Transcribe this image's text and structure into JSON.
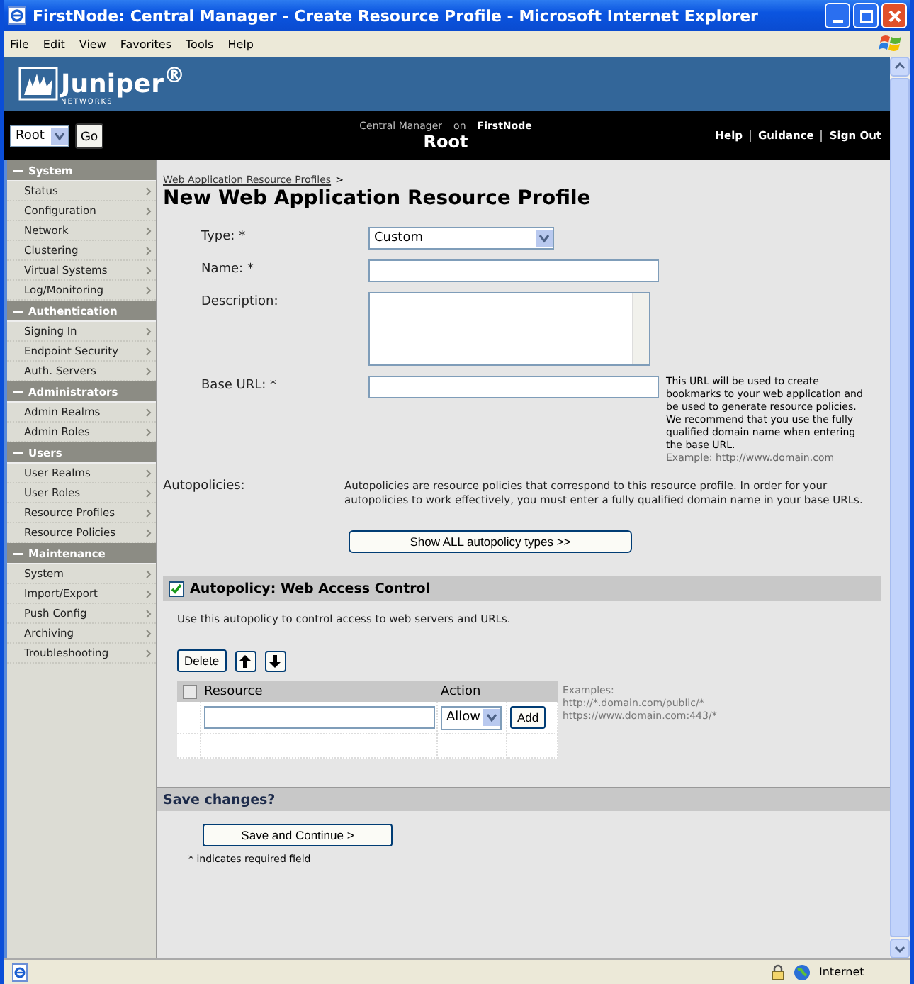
{
  "window": {
    "title": "FirstNode: Central Manager - Create Resource Profile - Microsoft Internet Explorer"
  },
  "menu_bar": [
    "File",
    "Edit",
    "View",
    "Favorites",
    "Tools",
    "Help"
  ],
  "header": {
    "logo_text": "Juniper$^{®}$",
    "logo_subtext": "NETWORKS",
    "context_select": "Root",
    "go_button": "Go",
    "app_name": "Central Manager",
    "on_word": "on",
    "node_name": "FirstNode",
    "title": "Root",
    "links": [
      "Help",
      "Guidance",
      "Sign Out"
    ]
  },
  "sidebar": [
    {
      "title": "System",
      "items": [
        "Status",
        "Configuration",
        "Network",
        "Clustering",
        "Virtual Systems",
        "Log/Monitoring"
      ]
    },
    {
      "title": "Authentication",
      "items": [
        "Signing In",
        "Endpoint Security",
        "Auth. Servers"
      ]
    },
    {
      "title": "Administrators",
      "items": [
        "Admin Realms",
        "Admin Roles"
      ]
    },
    {
      "title": "Users",
      "items": [
        "User Realms",
        "User Roles",
        "Resource Profiles",
        "Resource Policies"
      ]
    },
    {
      "title": "Maintenance",
      "items": [
        "System",
        "Import/Export",
        "Push Config",
        "Archiving",
        "Troubleshooting"
      ]
    }
  ],
  "breadcrumb": {
    "link": "Web Application Resource Profiles",
    "separator": ">"
  },
  "page_title": "New Web Application Resource Profile",
  "form": [
    {
      "kind": "select",
      "label": "Type: *",
      "value": "Custom"
    },
    {
      "kind": "text",
      "label": "Name: *"
    },
    {
      "kind": "textarea",
      "label": "Description:"
    },
    {
      "kind": "text",
      "label": "Base URL: *",
      "help": "This URL will be used to create bookmarks to your web application and be used to generate resource policies. We recommend that you use the fully qualified domain name when entering the base URL.",
      "example": "Example: http://www.domain.com"
    }
  ],
  "autopolicies": {
    "label": "Autopolicies:",
    "text": "Autopolicies are resource policies that correspond to this resource profile. In order for your autopolicies to work effectively, you must enter a fully qualified domain name in your base URLs.",
    "button": "Show ALL autopolicy types >>"
  },
  "autopolicy": {
    "title": "Autopolicy: Web Access Control",
    "checked": true,
    "description": "Use this autopolicy to control access to web servers and URLs.",
    "delete_button": "Delete",
    "select_all_checked": false,
    "columns": [
      "Resource",
      "Action"
    ],
    "action_value": "Allow",
    "add_button": "Add",
    "examples_label": "Examples:",
    "examples": [
      "http://*.domain.com/public/*",
      "https://www.domain.com:443/*"
    ]
  },
  "save": {
    "title": "Save changes?",
    "button": "Save and Continue >",
    "note": "* indicates required field"
  },
  "status_bar": {
    "zone": "Internet"
  }
}
